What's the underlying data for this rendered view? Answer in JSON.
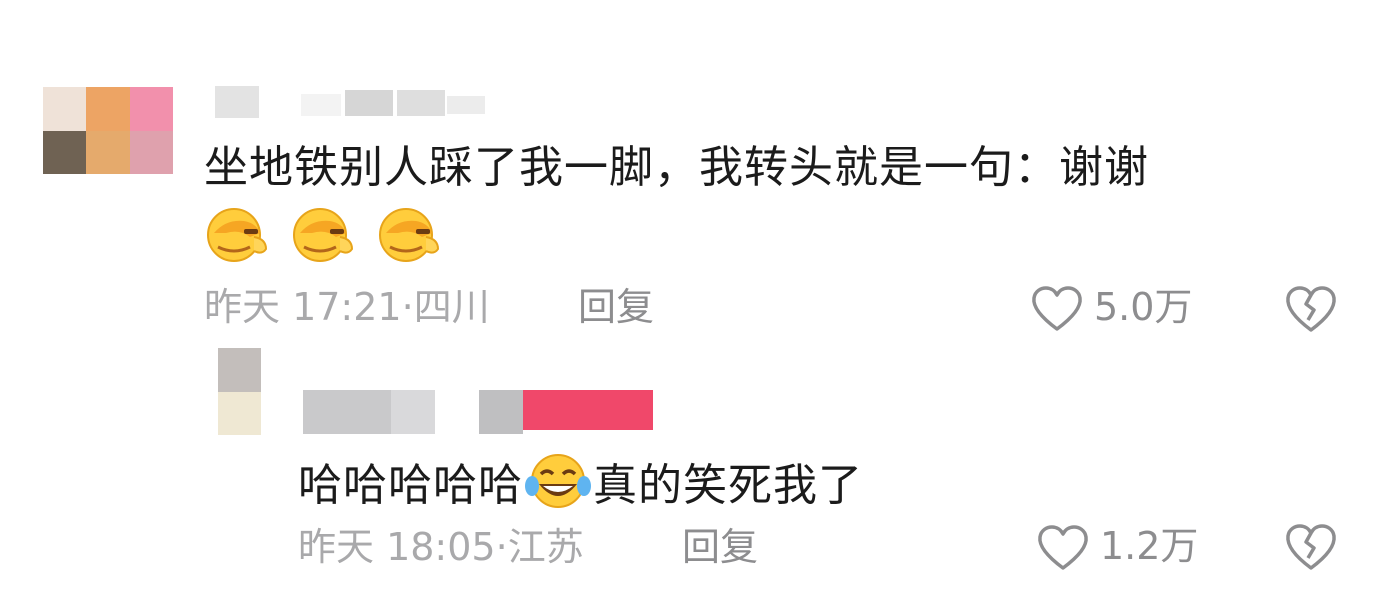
{
  "comments": [
    {
      "text": "坐地铁别人踩了我一脚，我转头就是一句：谢谢",
      "emoji": "facepalm-emoji",
      "emoji_count": 3,
      "time": "昨天 17:21",
      "location": "四川",
      "reply_label": "回复",
      "likes": "5.0万"
    },
    {
      "text_before": "哈哈哈哈哈",
      "emoji": "tears-of-joy-emoji",
      "text_after": "真的笑死我了",
      "time": "昨天 18:05",
      "location": "江苏",
      "reply_label": "回复",
      "likes": "1.2万"
    }
  ],
  "separator": "·",
  "icons": {
    "like": "heart-outline-icon",
    "dislike": "broken-heart-icon"
  },
  "colors": {
    "text": "#1b1b1b",
    "meta": "#a9a9ab",
    "action": "#8d8d8f",
    "redacted_pink": "#f0486a"
  }
}
